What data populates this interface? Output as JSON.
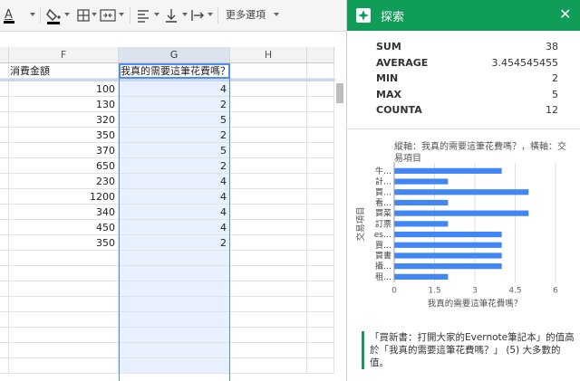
{
  "grid": {
    "columns": [
      {
        "id": "F",
        "label": "F"
      },
      {
        "id": "G",
        "label": "G"
      },
      {
        "id": "H",
        "label": "H"
      }
    ],
    "header_f": "消費金額",
    "header_g": "我真的需要這筆花費嗎？",
    "rows": [
      {
        "f": "100",
        "g": "4"
      },
      {
        "f": "130",
        "g": "2"
      },
      {
        "f": "320",
        "g": "5"
      },
      {
        "f": "350",
        "g": "2"
      },
      {
        "f": "370",
        "g": "5"
      },
      {
        "f": "650",
        "g": "2"
      },
      {
        "f": "230",
        "g": "4"
      },
      {
        "f": "1200",
        "g": "4"
      },
      {
        "f": "340",
        "g": "4"
      },
      {
        "f": "450",
        "g": "4"
      },
      {
        "f": "350",
        "g": "2"
      }
    ]
  },
  "toolbar": {
    "more_label": "更多選項"
  },
  "explore": {
    "title": "探索",
    "stats": [
      {
        "label": "SUM",
        "value": "38"
      },
      {
        "label": "AVERAGE",
        "value": "3.454545455"
      },
      {
        "label": "MIN",
        "value": "2"
      },
      {
        "label": "MAX",
        "value": "5"
      },
      {
        "label": "COUNTA",
        "value": "12"
      }
    ],
    "insight": "「買新書：打開大家的Evernote筆記本」的值高於「我真的需要這筆花費嗎？」 (5) 大多數的值。",
    "accent": "#0f9d58"
  },
  "chart_data": {
    "type": "bar",
    "orientation": "horizontal",
    "title": "縱軸：我真的需要這筆花費嗎？，橫軸：交易項目",
    "xlabel": "我真的需要這筆花費嗎？",
    "ylabel": "交易項目",
    "categories": [
      "牛…",
      "計…",
      "買…",
      "看…",
      "買菜",
      "訂票",
      "es…",
      "買…",
      "買書",
      "攝…",
      "租…"
    ],
    "values": [
      4,
      2,
      5,
      2,
      5,
      2,
      4,
      4,
      4,
      4,
      2
    ],
    "xlim": [
      0,
      6
    ],
    "xticks": [
      "0",
      "1.5",
      "3",
      "4.5",
      "6"
    ],
    "bar_color": "#4285f4",
    "grid": true
  }
}
